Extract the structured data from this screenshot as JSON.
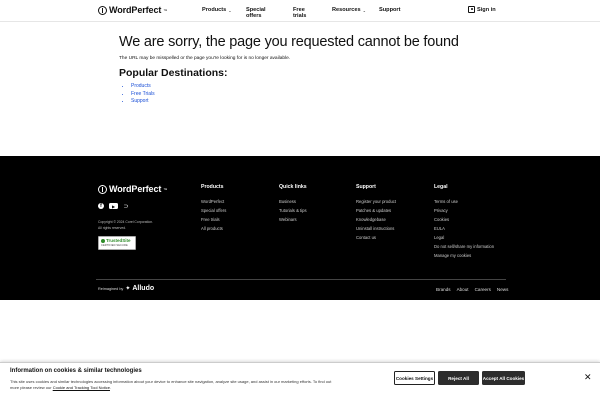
{
  "header": {
    "brand": "WordPerfect",
    "brand_tm": "™",
    "nav": [
      {
        "label": "Products",
        "chevron": "⌄"
      },
      {
        "label": "Special offers"
      },
      {
        "label": "Free trials"
      },
      {
        "label": "Resources",
        "chevron": "⌄"
      },
      {
        "label": "Support"
      }
    ],
    "signin_label": "Sign in"
  },
  "main": {
    "title": "We are sorry, the page you requested cannot be found",
    "subtext": "The URL may be misspelled or the page you're looking for is no longer available.",
    "popular_title": "Popular Destinations:",
    "popular_links": [
      "Products",
      "Free Trials",
      "Support"
    ]
  },
  "footer": {
    "brand": "WordPerfect",
    "brand_tm": "™",
    "copyright_line1": "Copyright © 2024 Corel Corporation.",
    "copyright_line2": "All rights reserved.",
    "trusted_title": "TrustedSite",
    "trusted_sub": "CERTIFIED SECURE",
    "columns": {
      "products": {
        "title": "Products",
        "items": [
          "WordPerfect",
          "Special offers",
          "Free trials",
          "All products"
        ]
      },
      "quick_links": {
        "title": "Quick links",
        "items": [
          "Business",
          "Tutorials & tips",
          "Webinars"
        ]
      },
      "support": {
        "title": "Support",
        "items": [
          "Register your product",
          "Patches & updates",
          "Knowledgebase",
          "Uninstall instructions",
          "Contact us"
        ]
      },
      "legal": {
        "title": "Legal",
        "items": [
          "Terms of use",
          "Privacy",
          "Cookies",
          "EULA",
          "Legal",
          "Do not sell/share my information",
          "Manage my cookies"
        ]
      }
    },
    "reimagined_label": "Reimagined by",
    "alludo": "Alludo",
    "bottom_links": [
      "Brands",
      "About",
      "Careers",
      "News"
    ]
  },
  "cookie_banner": {
    "title": "Information on cookies & similar technologies",
    "text_part1": "This site uses cookies and similar technologies accessing information about your device to enhance site navigation, analyze site usage, and assist in our marketing efforts. To find out more please review our ",
    "link_text": "Cookie and Tracking Tool Notice",
    "text_part2": ".",
    "settings_label": "Cookies Settings",
    "reject_label": "Reject All",
    "accept_label": "Accept All Cookies",
    "close_glyph": "✕"
  },
  "icons": {
    "facebook": "f",
    "youtube": "▶",
    "rss": "⊃"
  }
}
